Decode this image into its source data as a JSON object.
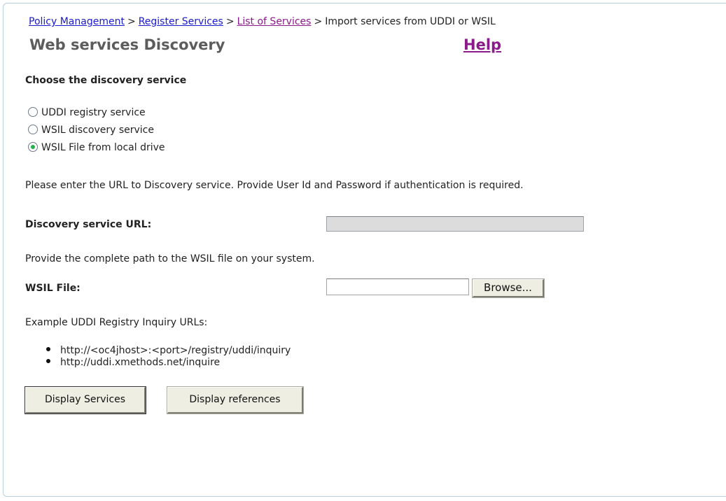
{
  "breadcrumb": {
    "items": [
      "Policy Management",
      "Register Services",
      "List of Services"
    ],
    "current": "Import services from UDDI or WSIL",
    "separator": ">"
  },
  "page": {
    "title": "Web services Discovery",
    "help_label": "Help"
  },
  "discovery": {
    "section_title": "Choose the discovery service",
    "options": [
      {
        "label": "UDDI registry service",
        "selected": false
      },
      {
        "label": "WSIL discovery service",
        "selected": false
      },
      {
        "label": "WSIL File from local drive",
        "selected": true
      }
    ]
  },
  "url_section": {
    "instruction": "Please enter the URL to Discovery service. Provide User Id and Password if authentication is required.",
    "label": "Discovery service URL:",
    "value": ""
  },
  "file_section": {
    "instruction": "Provide the complete path to the WSIL file on your system.",
    "label": "WSIL File:",
    "value": "",
    "browse_label": "Browse..."
  },
  "examples": {
    "heading": "Example UDDI Registry Inquiry URLs:",
    "urls": [
      "http://<oc4jhost>:<port>/registry/uddi/inquiry",
      "http://uddi.xmethods.net/inquire"
    ]
  },
  "actions": {
    "display_services": "Display Services",
    "display_references": "Display references"
  },
  "colors": {
    "link": "#1a1acc",
    "visited_link": "#8b1a8b",
    "title": "#5c5c5c",
    "radio_selected": "#24b24a",
    "button_bg": "#efeee2",
    "disabled_field": "#dcdcdc"
  }
}
